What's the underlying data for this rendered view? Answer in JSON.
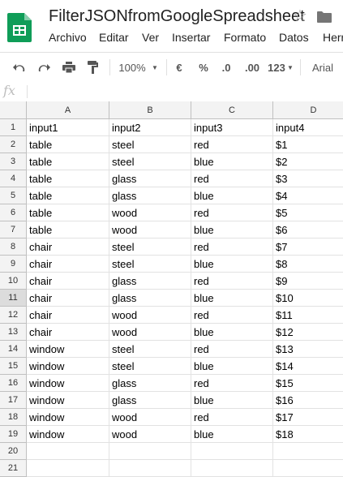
{
  "title": "FilterJSONfromGoogleSpreadsheet",
  "menu": [
    "Archivo",
    "Editar",
    "Ver",
    "Insertar",
    "Formato",
    "Datos",
    "Herr"
  ],
  "toolbar": {
    "zoom": "100%",
    "currency": "€",
    "percent": "%",
    "dec_decrease": ".0",
    "dec_increase": ".00",
    "format": "123",
    "font": "Arial"
  },
  "formula_bar": {
    "fx": "fx",
    "value": ""
  },
  "columns": [
    "A",
    "B",
    "C",
    "D"
  ],
  "rows": [
    [
      "input1",
      "input2",
      "input3",
      "input4"
    ],
    [
      "table",
      "steel",
      "red",
      "$1"
    ],
    [
      "table",
      "steel",
      "blue",
      "$2"
    ],
    [
      "table",
      "glass",
      "red",
      "$3"
    ],
    [
      "table",
      "glass",
      "blue",
      "$4"
    ],
    [
      "table",
      "wood",
      "red",
      "$5"
    ],
    [
      "table",
      "wood",
      "blue",
      "$6"
    ],
    [
      "chair",
      "steel",
      "red",
      "$7"
    ],
    [
      "chair",
      "steel",
      "blue",
      "$8"
    ],
    [
      "chair",
      "glass",
      "red",
      "$9"
    ],
    [
      "chair",
      "glass",
      "blue",
      "$10"
    ],
    [
      "chair",
      "wood",
      "red",
      "$11"
    ],
    [
      "chair",
      "wood",
      "blue",
      "$12"
    ],
    [
      "window",
      "steel",
      "red",
      "$13"
    ],
    [
      "window",
      "steel",
      "blue",
      "$14"
    ],
    [
      "window",
      "glass",
      "red",
      "$15"
    ],
    [
      "window",
      "glass",
      "blue",
      "$16"
    ],
    [
      "window",
      "wood",
      "red",
      "$17"
    ],
    [
      "window",
      "wood",
      "blue",
      "$18"
    ],
    [
      "",
      "",
      "",
      ""
    ],
    [
      "",
      "",
      "",
      ""
    ]
  ],
  "row_numbers": [
    "1",
    "2",
    "3",
    "4",
    "5",
    "6",
    "7",
    "8",
    "9",
    "10",
    "11",
    "12",
    "13",
    "14",
    "15",
    "16",
    "17",
    "18",
    "19",
    "20",
    "21"
  ],
  "selected_row": "11",
  "colors": {
    "logo": "#0f9d58",
    "header_bg": "#f3f3f3",
    "grid": "#e2e2e2"
  }
}
